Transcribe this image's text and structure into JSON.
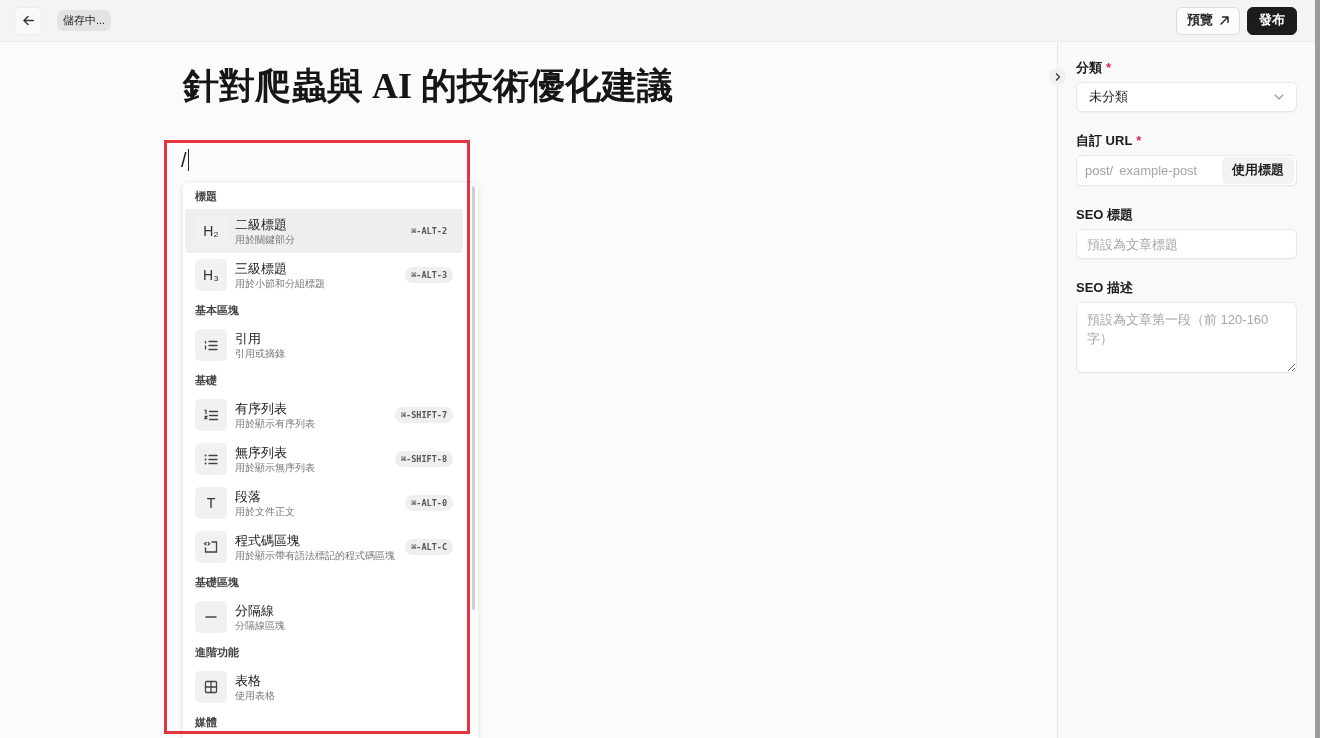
{
  "topbar": {
    "status_badge": "儲存中...",
    "buttons": [
      {
        "kind": "secondary",
        "label": "預覽"
      },
      {
        "kind": "primary",
        "label": "發布"
      }
    ]
  },
  "editor": {
    "title": "針對爬蟲與 AI 的技術優化建議",
    "input_line": "/"
  },
  "command_menu": {
    "sections": [
      {
        "heading": "標題",
        "items": [
          {
            "kind": "heading",
            "glyph": "H₂",
            "title": "二級標題",
            "description": "用於關鍵部分",
            "shortcut": "⌘-ALT-2",
            "selected": true
          },
          {
            "kind": "heading",
            "glyph": "H₃",
            "title": "三級標題",
            "description": "用於小節和分組標題",
            "shortcut": "⌘-ALT-3",
            "selected": false
          }
        ]
      },
      {
        "heading": "基本區塊",
        "items": [
          {
            "kind": "quote",
            "title": "引用",
            "description": "引用或摘錄",
            "selected": false
          }
        ]
      },
      {
        "heading": "基礎",
        "items": [
          {
            "kind": "ordered_list",
            "title": "有序列表",
            "description": "用於顯示有序列表",
            "shortcut": "⌘-SHIFT-7",
            "selected": false
          },
          {
            "kind": "bullet_list",
            "title": "無序列表",
            "description": "用於顯示無序列表",
            "shortcut": "⌘-SHIFT-8",
            "selected": false
          },
          {
            "kind": "paragraph",
            "glyph": "T",
            "title": "段落",
            "description": "用於文件正文",
            "shortcut": "⌘-ALT-0",
            "selected": false
          },
          {
            "kind": "code_block",
            "title": "程式碼區塊",
            "description": "用於顯示帶有語法標記的程式碼區塊",
            "shortcut": "⌘-ALT-C",
            "selected": false
          }
        ]
      },
      {
        "heading": "基礎區塊",
        "items": [
          {
            "kind": "divider",
            "title": "分隔線",
            "description": "分隔線區塊",
            "selected": false
          }
        ]
      },
      {
        "heading": "進階功能",
        "items": [
          {
            "kind": "table",
            "title": "表格",
            "description": "使用表格",
            "selected": false
          }
        ]
      },
      {
        "heading": "媒體"
      }
    ]
  },
  "sidebar": {
    "fields": [
      {
        "kind": "select",
        "label": "分類",
        "required_mark": "*",
        "value": "未分類"
      },
      {
        "kind": "url",
        "label": "自訂 URL",
        "required_mark": "*",
        "prefix": "post/",
        "placeholder": "example-post",
        "button": "使用標題"
      },
      {
        "kind": "text",
        "label": "SEO 標題",
        "placeholder": "預設為文章標題"
      },
      {
        "kind": "textarea",
        "label": "SEO 描述",
        "placeholder": "預設為文章第一段（前 120-160 字）"
      }
    ]
  }
}
